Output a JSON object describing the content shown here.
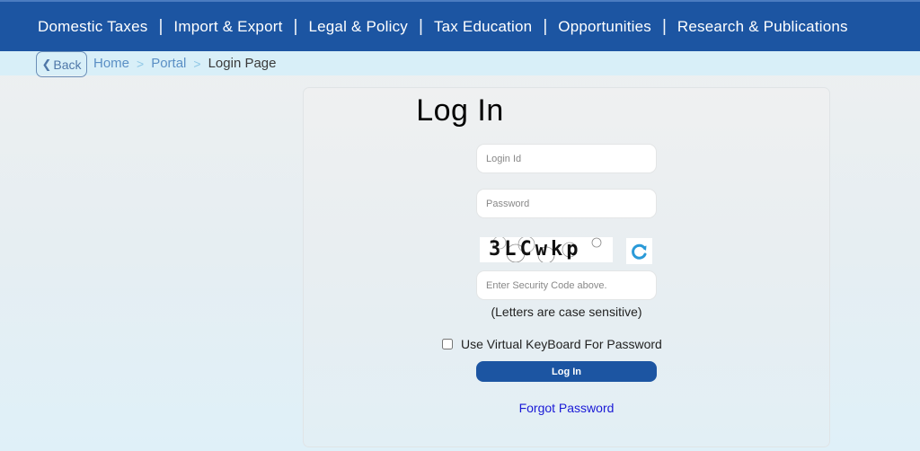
{
  "topnav": {
    "items": [
      {
        "label": "Domestic Taxes"
      },
      {
        "label": "Import & Export"
      },
      {
        "label": "Legal & Policy"
      },
      {
        "label": "Tax Education"
      },
      {
        "label": "Opportunities"
      },
      {
        "label": "Research & Publications"
      }
    ],
    "separator": "|"
  },
  "breadcrumb": {
    "back_label": "Back",
    "back_icon": "chevron-left-icon",
    "arrow": ">",
    "items": [
      {
        "label": "Home"
      },
      {
        "label": "Portal"
      }
    ],
    "current": "Login Page"
  },
  "login": {
    "title": "Log In",
    "login_id": {
      "value": "",
      "placeholder": "Login Id"
    },
    "password": {
      "value": "",
      "placeholder": "Password"
    },
    "captcha": {
      "code": "3LCwkp",
      "refresh_icon": "refresh-icon"
    },
    "security_code": {
      "value": "",
      "placeholder": "Enter Security Code above."
    },
    "case_hint": "(Letters are case sensitive)",
    "virtual_keyboard": {
      "label": "Use Virtual KeyBoard For Password",
      "checked": false
    },
    "submit_label": "Log In",
    "forgot_label": "Forgot Password"
  },
  "colors": {
    "brand_blue": "#1c55a2",
    "breadcrumb_bg": "#d8eff8",
    "link_blue": "#1a1ad6",
    "refresh_blue": "#2a9ad8"
  }
}
